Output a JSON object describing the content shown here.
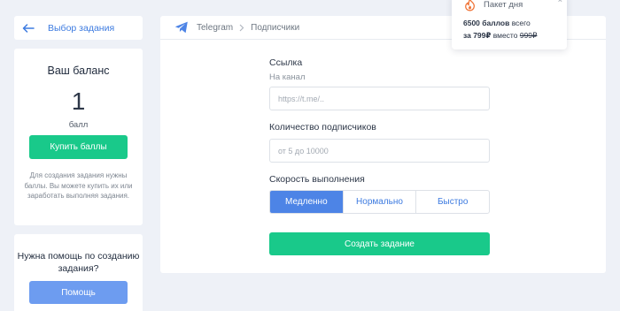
{
  "nav": {
    "back_label": "Выбор задания"
  },
  "balance": {
    "title": "Ваш баланс",
    "value": "1",
    "unit": "балл",
    "buy_button": "Купить баллы",
    "note": "Для создания задания нужны баллы. Вы можете купить их или заработать выполняя задания."
  },
  "help": {
    "title": "Нужна помощь по созданию задания?",
    "button": "Помощь"
  },
  "breadcrumb": {
    "items": [
      "Telegram",
      "Подписчики"
    ]
  },
  "form": {
    "link_label": "Ссылка",
    "link_sublabel": "На канал",
    "link_placeholder": "https://t.me/..",
    "count_label": "Количество подписчиков",
    "count_placeholder": "от 5 до 10000",
    "speed_label": "Скорость выполнения",
    "speed_options": [
      "Медленно",
      "Нормально",
      "Быстро"
    ],
    "speed_selected": "Медленно",
    "submit_button": "Создать задание"
  },
  "promo": {
    "title": "Пакет дня",
    "points": "6500 баллов",
    "points_suffix": "всего",
    "price": "за 799₽",
    "price_mid": "вместо",
    "old_price": "999₽",
    "close": "×"
  },
  "colors": {
    "accent_blue": "#4d84e6",
    "accent_green": "#19c98a",
    "help_blue": "#6d9cf0",
    "background": "#eef1f7",
    "fire_orange": "#f0763a"
  }
}
